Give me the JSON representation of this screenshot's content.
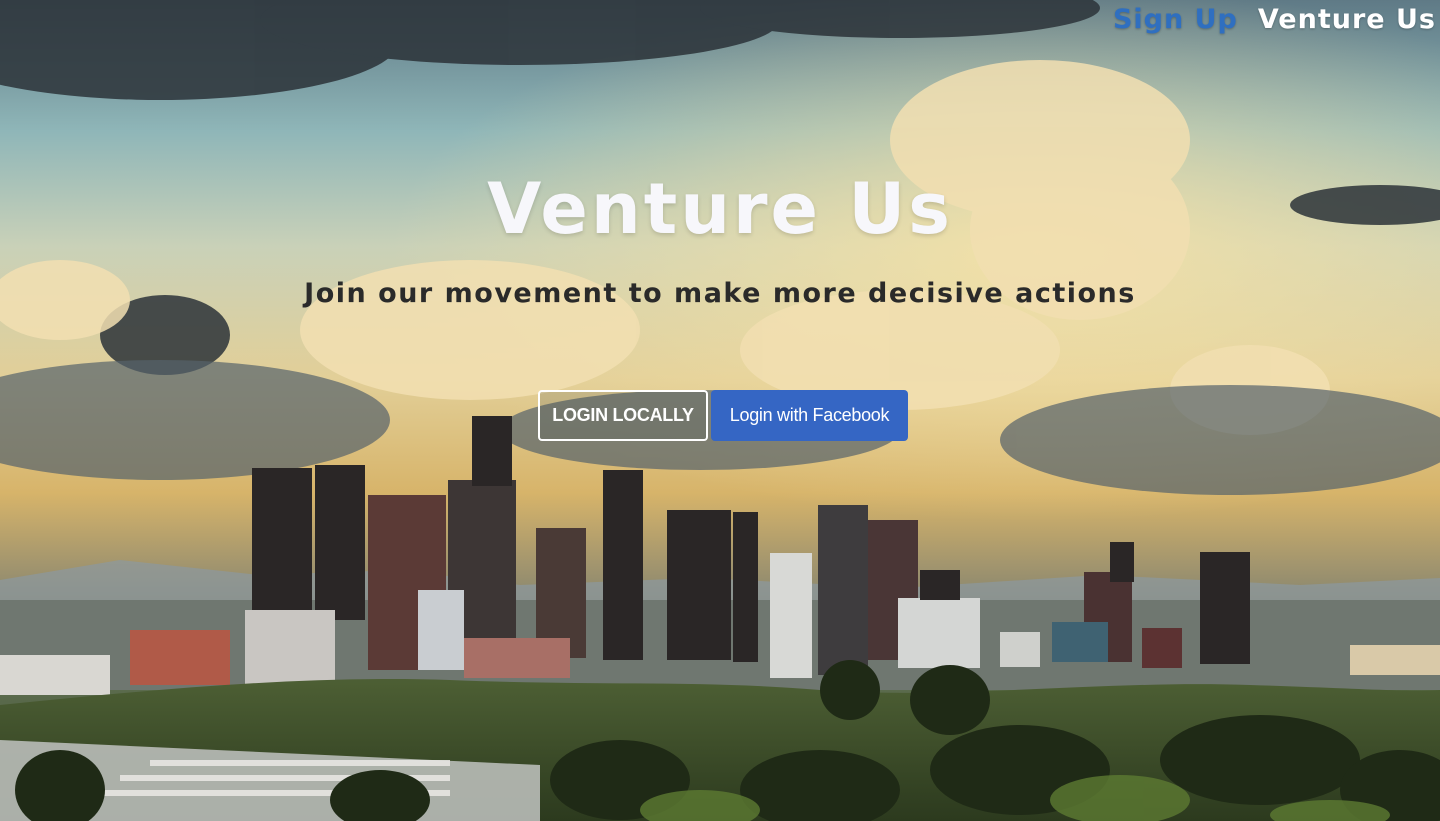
{
  "nav": {
    "signup_label": "Sign Up",
    "brand_label": "Venture Us"
  },
  "hero": {
    "title": "Venture Us",
    "subtitle": "Join our movement to make more decisive actions"
  },
  "actions": {
    "login_local_label": "LOGIN LOCALLY",
    "login_facebook_label": "Login with Facebook"
  },
  "colors": {
    "signup_link": "#2f6fc0",
    "brand_link": "#ffffff",
    "facebook_button": "#3566c4"
  }
}
